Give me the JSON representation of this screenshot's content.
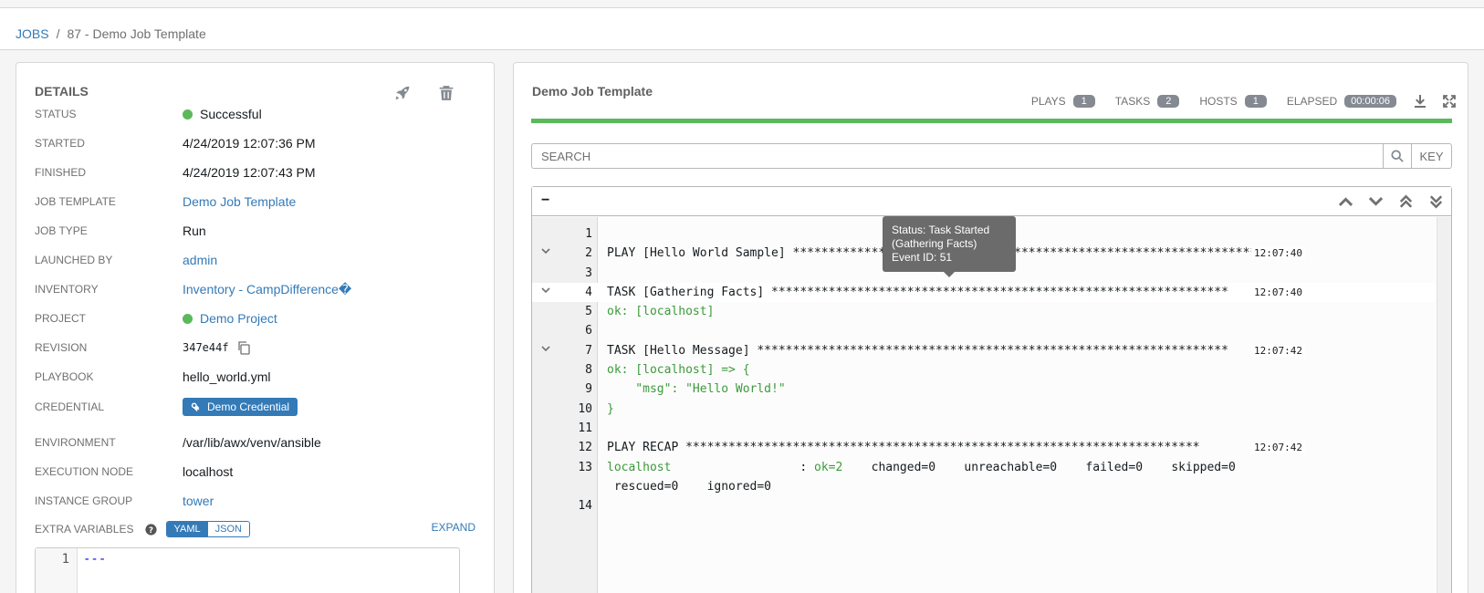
{
  "breadcrumb": {
    "jobs": "JOBS",
    "sep": "/",
    "current": "87 - Demo Job Template"
  },
  "details": {
    "title": "DETAILS",
    "rows": [
      {
        "label": "STATUS",
        "value": "Successful"
      },
      {
        "label": "STARTED",
        "value": "4/24/2019 12:07:36 PM"
      },
      {
        "label": "FINISHED",
        "value": "4/24/2019 12:07:43 PM"
      },
      {
        "label": "JOB TEMPLATE",
        "value": "Demo Job Template"
      },
      {
        "label": "JOB TYPE",
        "value": "Run"
      },
      {
        "label": "LAUNCHED BY",
        "value": "admin"
      },
      {
        "label": "INVENTORY",
        "value": "Inventory - CampDifference�"
      },
      {
        "label": "PROJECT",
        "value": "Demo Project"
      },
      {
        "label": "REVISION",
        "value": "347e44f"
      },
      {
        "label": "PLAYBOOK",
        "value": "hello_world.yml"
      },
      {
        "label": "CREDENTIAL",
        "value": "Demo Credential"
      },
      {
        "label": "ENVIRONMENT",
        "value": "/var/lib/awx/venv/ansible"
      },
      {
        "label": "EXECUTION NODE",
        "value": "localhost"
      },
      {
        "label": "INSTANCE GROUP",
        "value": "tower"
      }
    ],
    "extra_vars": {
      "label": "EXTRA VARIABLES",
      "yaml": "YAML",
      "json": "JSON",
      "expand": "EXPAND",
      "line_num": "1",
      "code": "---"
    }
  },
  "output": {
    "title": "Demo Job Template",
    "plays_label": "PLAYS",
    "plays": "1",
    "tasks_label": "TASKS",
    "tasks": "2",
    "hosts_label": "HOSTS",
    "hosts": "1",
    "elapsed_label": "ELAPSED",
    "elapsed": "00:00:06",
    "progress": 1.0,
    "search_placeholder": "SEARCH",
    "key_label": "KEY",
    "collapse_label": "−",
    "lines": [
      {
        "n": "1",
        "text": "",
        "time": ""
      },
      {
        "n": "2",
        "text": "PLAY [Hello World Sample] *********************************************************************",
        "time": "12:07:40"
      },
      {
        "n": "3",
        "text": "",
        "time": ""
      },
      {
        "n": "4",
        "text": "TASK [Gathering Facts] ****************************************************************",
        "time": "12:07:40"
      },
      {
        "n": "5",
        "text": "ok: [localhost]",
        "time": ""
      },
      {
        "n": "6",
        "text": "",
        "time": ""
      },
      {
        "n": "7",
        "text": "TASK [Hello Message] ******************************************************************",
        "time": "12:07:42"
      },
      {
        "n": "8",
        "text": "ok: [localhost] => {",
        "time": ""
      },
      {
        "n": "9",
        "text": "    \"msg\": \"Hello World!\"",
        "time": ""
      },
      {
        "n": "10",
        "text": "}",
        "time": ""
      },
      {
        "n": "11",
        "text": "",
        "time": ""
      },
      {
        "n": "12",
        "text": "PLAY RECAP ************************************************************************",
        "time": "12:07:42"
      },
      {
        "n": "13",
        "text": "localhost                  : ok=2    changed=0    unreachable=0    failed=0    skipped=0",
        "time": ""
      },
      {
        "n": "",
        "text": " rescued=0    ignored=0",
        "time": ""
      },
      {
        "n": "14",
        "text": "",
        "time": ""
      }
    ],
    "tooltip": {
      "line1": "Status: Task Started",
      "line2": "(Gathering Facts)",
      "line3": "Event ID: 51"
    }
  },
  "colors": {
    "accent": "#337ab7",
    "success": "#5cb85c",
    "ok_text": "#3c9a3c",
    "badge": "#848992"
  }
}
